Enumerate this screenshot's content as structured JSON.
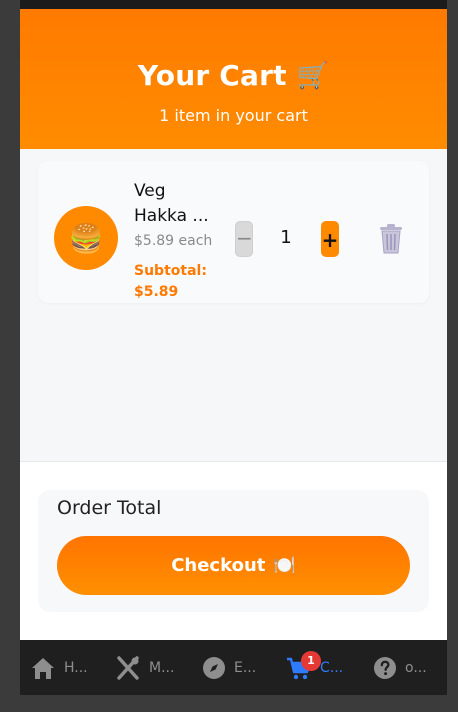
{
  "header": {
    "title": "Your Cart",
    "subtitle": "1 item in your cart"
  },
  "cart": {
    "items": [
      {
        "name": "Veg Hakka ...",
        "price_each": "$5.89 each",
        "subtotal": "Subtotal: $5.89",
        "quantity": "1",
        "minus_label": "−",
        "plus_label": "+"
      }
    ]
  },
  "summary": {
    "total_label": "Order Total",
    "checkout_label": "Checkout"
  },
  "tabbar": {
    "tabs": [
      {
        "label": "H...",
        "icon": "home-icon"
      },
      {
        "label": "M...",
        "icon": "utensils-icon"
      },
      {
        "label": "E...",
        "icon": "compass-icon"
      },
      {
        "label": "C...",
        "icon": "cart-icon",
        "active": true,
        "badge": "1"
      },
      {
        "label": "o...",
        "icon": "help-icon"
      }
    ]
  },
  "colors": {
    "accent": "#ff7a00",
    "active_tab": "#2f7bff",
    "badge": "#e53935"
  }
}
